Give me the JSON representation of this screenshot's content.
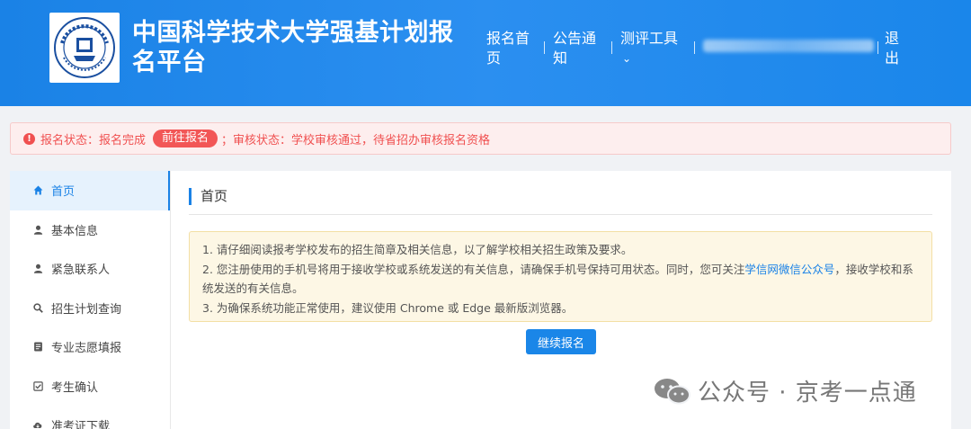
{
  "header": {
    "title": "中国科学技术大学强基计划报名平台",
    "nav": {
      "home": "报名首页",
      "notice": "公告通知",
      "tools": "测评工具",
      "tools_chevron": "⌄",
      "logout": "退出"
    }
  },
  "status": {
    "icon": "!",
    "prefix": "报名状态：报名完成",
    "goto_label": "前往报名",
    "suffix": "；审核状态：学校审核通过，待省招办审核报名资格"
  },
  "sidebar": {
    "items": [
      {
        "label": "首页",
        "icon": "home-icon"
      },
      {
        "label": "基本信息",
        "icon": "user-icon"
      },
      {
        "label": "紧急联系人",
        "icon": "user-icon"
      },
      {
        "label": "招生计划查询",
        "icon": "search-icon"
      },
      {
        "label": "专业志愿填报",
        "icon": "form-icon"
      },
      {
        "label": "考生确认",
        "icon": "checkbox-icon"
      },
      {
        "label": "准考证下载",
        "icon": "cloud-download-icon"
      }
    ]
  },
  "main": {
    "title": "首页",
    "notice": {
      "line1": "1. 请仔细阅读报考学校发布的招生简章及相关信息，以了解学校相关招生政策及要求。",
      "line2_a": "2. 您注册使用的手机号将用于接收学校或系统发送的有关信息，请确保手机号保持可用状态。同时，您可关注",
      "line2_link": "学信网微信公众号",
      "line2_b": "，接收学校和系统发送的有关信息。",
      "line3": "3. 为确保系统功能正常使用，建议使用 Chrome 或 Edge 最新版浏览器。"
    },
    "continue_label": "继续报名"
  },
  "watermark": {
    "text": "公众号 · 京考一点通"
  },
  "colors": {
    "header_blue": "#1a82e6",
    "alert_red": "#f05050",
    "notice_bg": "#fdf7e5",
    "link_blue": "#1a82e6"
  }
}
